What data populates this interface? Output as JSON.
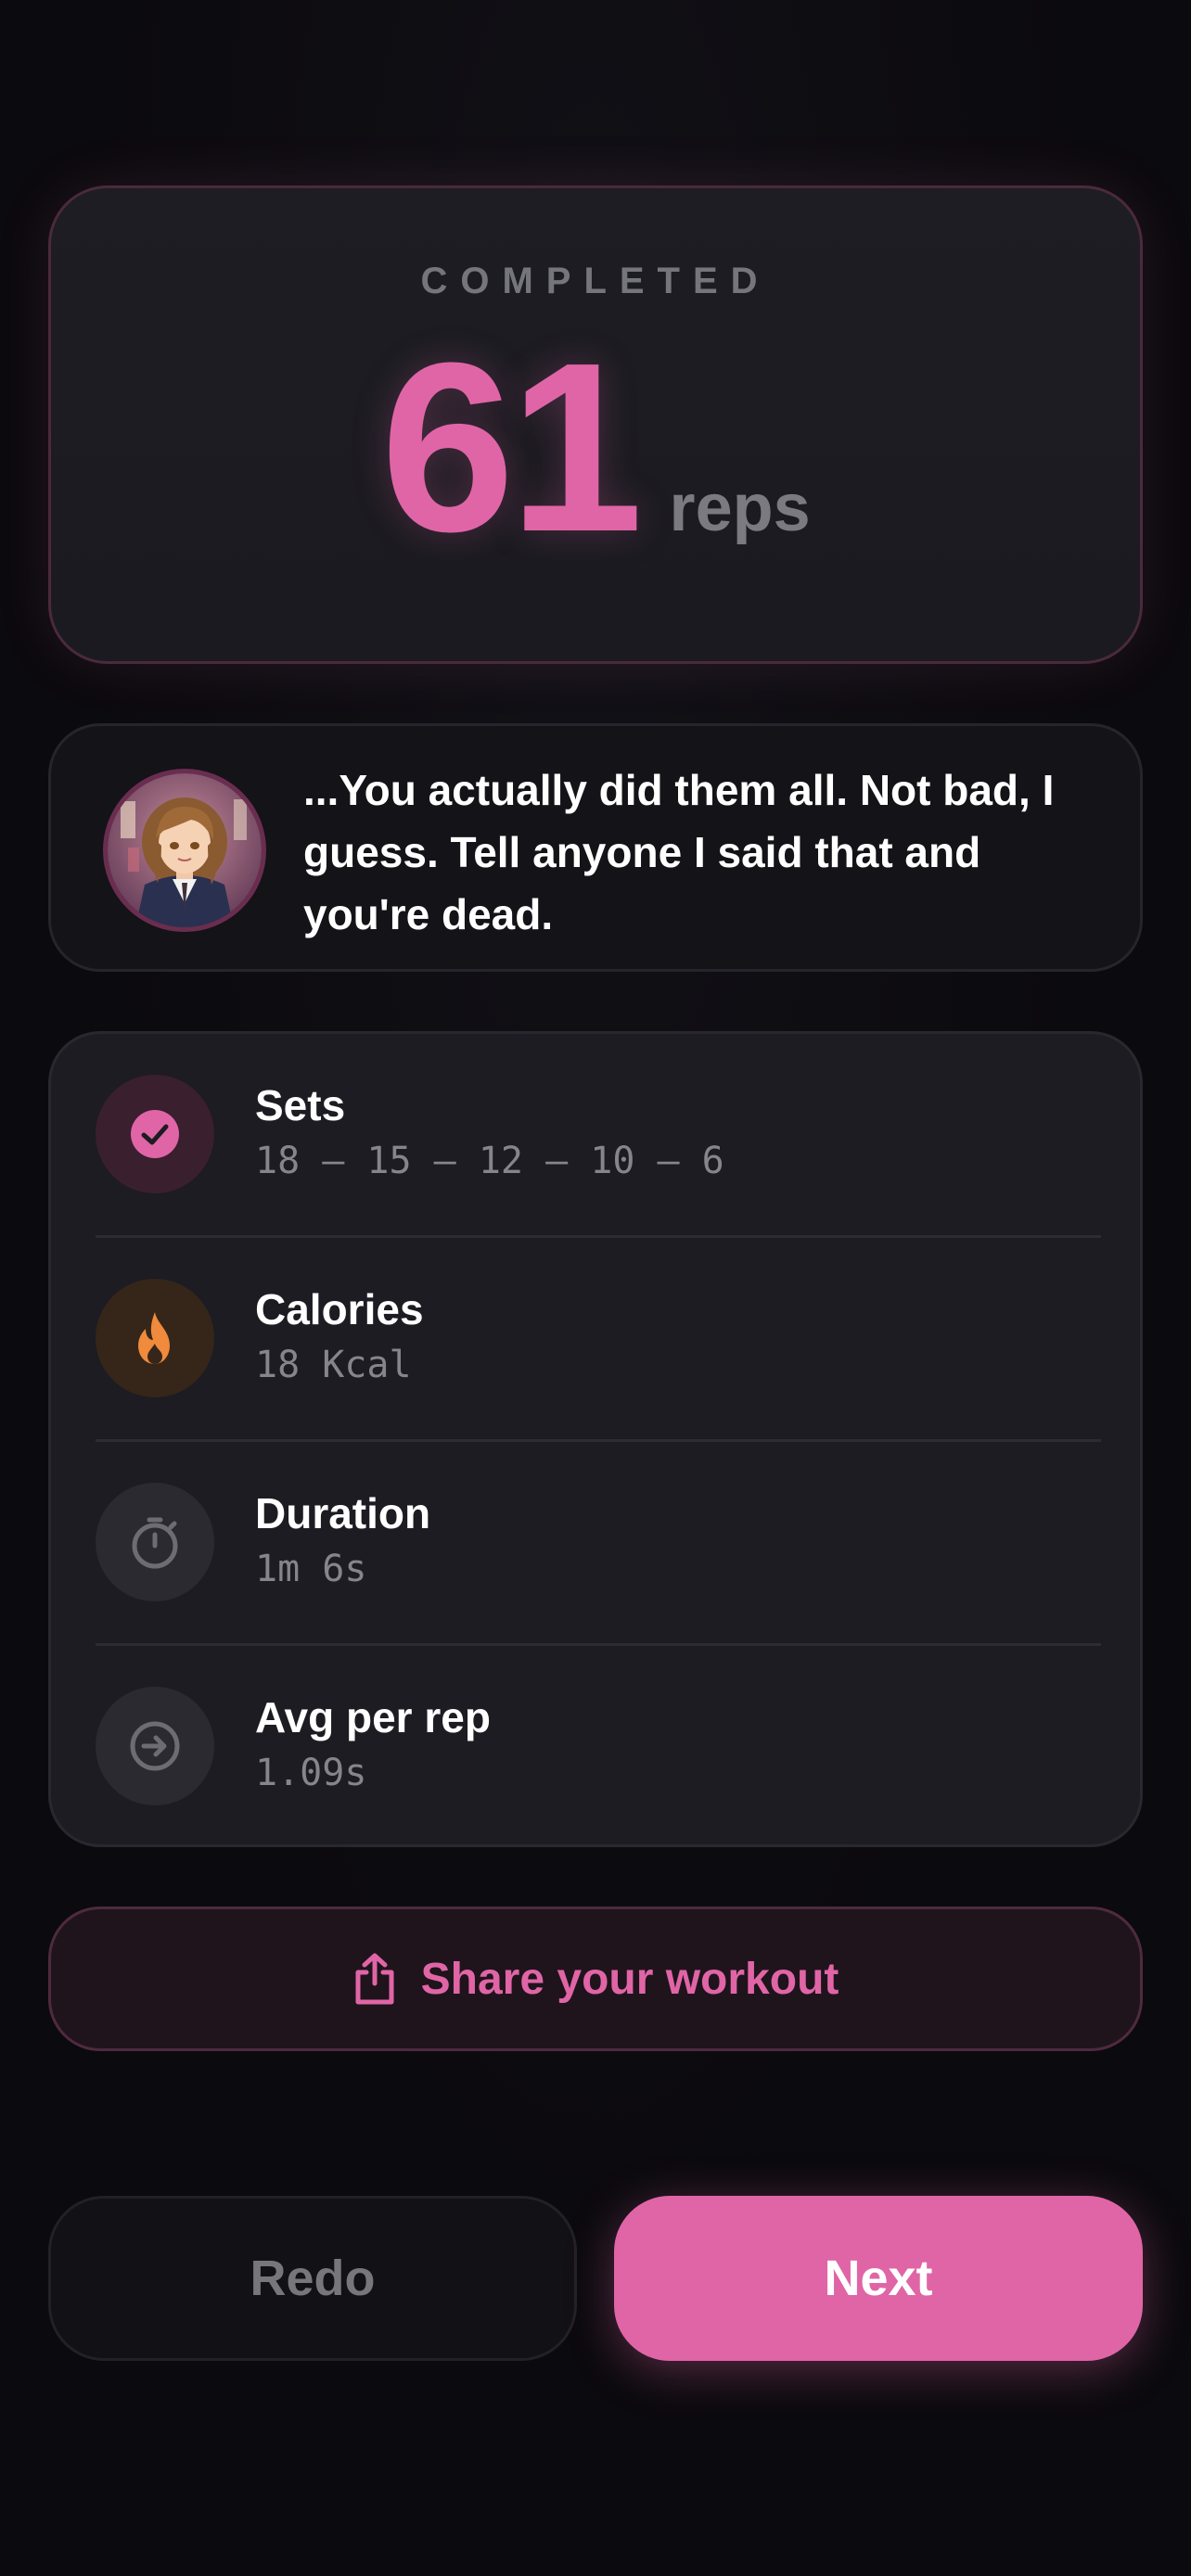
{
  "summary": {
    "completed_label": "COMPLETED",
    "reps_count": "61",
    "reps_unit": "reps"
  },
  "coach": {
    "avatar_icon": "anime-character-avatar",
    "quote": "...You actually did them all. Not bad, I guess. Tell anyone I said that and you're dead."
  },
  "stats": [
    {
      "icon": "checkmark-icon",
      "label": "Sets",
      "value": "18 — 15 — 12 — 10 — 6",
      "accent": "#e065a6"
    },
    {
      "icon": "flame-icon",
      "label": "Calories",
      "value": "18 Kcal",
      "accent": "#f08a3c"
    },
    {
      "icon": "stopwatch-icon",
      "label": "Duration",
      "value": "1m 6s",
      "accent": "#6c6c72"
    },
    {
      "icon": "arrow-right-circle-icon",
      "label": "Avg per rep",
      "value": "1.09s",
      "accent": "#6c6c72"
    }
  ],
  "actions": {
    "share_label": "Share your workout",
    "redo_label": "Redo",
    "next_label": "Next"
  },
  "colors": {
    "accent": "#e065a6",
    "background": "#0b0a0e"
  }
}
